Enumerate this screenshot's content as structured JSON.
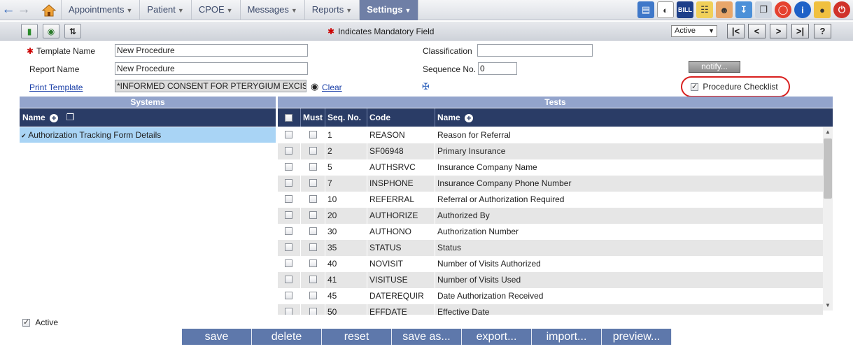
{
  "nav": {
    "menus": [
      {
        "label": "Appointments"
      },
      {
        "label": "Patient"
      },
      {
        "label": "CPOE"
      },
      {
        "label": "Messages"
      },
      {
        "label": "Reports"
      },
      {
        "label": "Settings"
      }
    ],
    "active_menu": "Settings",
    "bill_label": "BILL",
    "toolbar_icons": [
      "document-download-icon",
      "dashboard-gauge-icon",
      "bill-icon",
      "calendar-note-icon",
      "user-icon",
      "inbox-download-icon",
      "documents-icon",
      "lifebuoy-icon",
      "info-icon",
      "lock-icon",
      "power-icon"
    ]
  },
  "toolbar": {
    "mandatory_note": "Indicates Mandatory Field",
    "status_value": "Active",
    "pager": {
      "first": "|<",
      "prev": "<",
      "next": ">",
      "last": ">|",
      "help": "?"
    }
  },
  "form": {
    "template_name_label": "Template Name",
    "template_name_value": "New Procedure",
    "report_name_label": "Report Name",
    "report_name_value": "New Procedure",
    "print_template_label": "Print Template",
    "print_template_value": "*INFORMED CONSENT FOR PTERYGIUM EXCISION",
    "clear_label": "Clear",
    "classification_label": "Classification",
    "classification_value": "",
    "sequence_label": "Sequence No.",
    "sequence_value": "0",
    "notify_label": "notify...",
    "procedure_checklist_label": "Procedure Checklist",
    "procedure_checklist_checked": true
  },
  "systems": {
    "title": "Systems",
    "col_name": "Name",
    "items": [
      {
        "label": "Authorization Tracking Form Details"
      }
    ]
  },
  "tests": {
    "title": "Tests",
    "cols": {
      "must": "Must",
      "seq": "Seq. No.",
      "code": "Code",
      "name": "Name"
    },
    "rows": [
      {
        "seq": "1",
        "code": "REASON",
        "name": "Reason for Referral"
      },
      {
        "seq": "2",
        "code": "SF06948",
        "name": "Primary Insurance"
      },
      {
        "seq": "5",
        "code": "AUTHSRVC",
        "name": "Insurance Company Name"
      },
      {
        "seq": "7",
        "code": "INSPHONE",
        "name": "Insurance Company Phone Number"
      },
      {
        "seq": "10",
        "code": "REFERRAL",
        "name": "Referral or Authorization Required"
      },
      {
        "seq": "20",
        "code": "AUTHORIZE",
        "name": "Authorized By"
      },
      {
        "seq": "30",
        "code": "AUTHONO",
        "name": "Authorization Number"
      },
      {
        "seq": "35",
        "code": "STATUS",
        "name": "Status"
      },
      {
        "seq": "40",
        "code": "NOVISIT",
        "name": "Number of Visits Authorized"
      },
      {
        "seq": "41",
        "code": "VISITUSE",
        "name": "Number of Visits Used"
      },
      {
        "seq": "45",
        "code": "DATEREQUIR",
        "name": "Date Authorization Received"
      },
      {
        "seq": "50",
        "code": "EFFDATE",
        "name": "Effective Date"
      }
    ]
  },
  "bottom": {
    "active_label": "Active",
    "active_checked": true,
    "buttons": [
      "save",
      "delete",
      "reset",
      "save as...",
      "export...",
      "import...",
      "preview..."
    ]
  }
}
